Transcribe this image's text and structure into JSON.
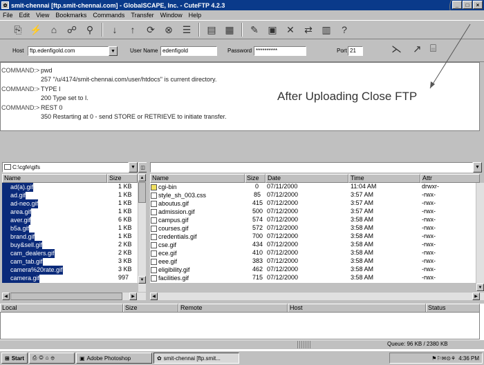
{
  "window": {
    "title": "smit-chennai [ftp.smit-chennai.com] - GlobalSCAPE, Inc. - CuteFTP 4.2.3",
    "controls": [
      "_",
      "□",
      "×"
    ]
  },
  "menu": [
    "File",
    "Edit",
    "View",
    "Bookmarks",
    "Commands",
    "Transfer",
    "Window",
    "Help"
  ],
  "toolbar_icons": [
    "disconnect-icon",
    "reconnect-icon",
    "quick-connect-icon",
    "site-manager-icon",
    "search-icon",
    "download-icon",
    "upload-icon",
    "refresh-icon",
    "stop-icon",
    "queue-icon",
    "view-icon",
    "list-icon",
    "edit-icon",
    "terminal-icon",
    "delete-icon",
    "rename-icon",
    "filter-icon",
    "help-icon"
  ],
  "connection": {
    "host_label": "Host",
    "host_value": "ftp.edenfigold.com",
    "user_label": "User Name",
    "user_value": "edenfigold",
    "password_label": "Password",
    "password_value": "**********",
    "port_label": "Port",
    "port_value": "21"
  },
  "log": [
    {
      "cmd": "COMMAND:>",
      "text": "pwd"
    },
    {
      "cmd": "",
      "text": "257 \"/u/4174/smit-chennai.com/user/htdocs\" is current directory."
    },
    {
      "cmd": "COMMAND:>",
      "text": "TYPE I"
    },
    {
      "cmd": "",
      "text": "200 Type set to I."
    },
    {
      "cmd": "COMMAND:>",
      "text": "REST 0"
    },
    {
      "cmd": "",
      "text": "350 Restarting at 0 - send STORE or RETRIEVE to initiate transfer."
    }
  ],
  "annotation": "After Uploading Close FTP",
  "local": {
    "path": "C:\\cgfe\\gifs",
    "headers": [
      "Name",
      "Size"
    ],
    "files": [
      {
        "name": "ad(a).gif",
        "size": "1 KB"
      },
      {
        "name": "ad.gif",
        "size": "1 KB"
      },
      {
        "name": "ad-neo.gif",
        "size": "1 KB"
      },
      {
        "name": "area.gif",
        "size": "1 KB"
      },
      {
        "name": "aver.gif",
        "size": "6 KB"
      },
      {
        "name": "b5a.gif",
        "size": "1 KB"
      },
      {
        "name": "brand.gif",
        "size": "1 KB"
      },
      {
        "name": "buy&sell.gif",
        "size": "2 KB"
      },
      {
        "name": "cam_dealers.gif",
        "size": "2 KB"
      },
      {
        "name": "cam_tab.gif",
        "size": "3 KB"
      },
      {
        "name": "camera%20rate.gif",
        "size": "3 KB"
      },
      {
        "name": "camera.gif",
        "size": "997"
      }
    ]
  },
  "remote": {
    "path": "",
    "headers": [
      "Name",
      "Size",
      "Date",
      "Time",
      "Attr"
    ],
    "files": [
      {
        "name": "cgi-bin",
        "size": "0",
        "date": "07/11/2000",
        "time": "11:04 AM",
        "attr": "drwxr-"
      },
      {
        "name": "style_sh_003.css",
        "size": "85",
        "date": "07/12/2000",
        "time": "3:57 AM",
        "attr": "-rwx-"
      },
      {
        "name": "aboutus.gif",
        "size": "415",
        "date": "07/12/2000",
        "time": "3:57 AM",
        "attr": "-rwx-"
      },
      {
        "name": "admission.gif",
        "size": "500",
        "date": "07/12/2000",
        "time": "3:57 AM",
        "attr": "-rwx-"
      },
      {
        "name": "campus.gif",
        "size": "574",
        "date": "07/12/2000",
        "time": "3:58 AM",
        "attr": "-rwx-"
      },
      {
        "name": "courses.gif",
        "size": "572",
        "date": "07/12/2000",
        "time": "3:58 AM",
        "attr": "-rwx-"
      },
      {
        "name": "credentials.gif",
        "size": "700",
        "date": "07/12/2000",
        "time": "3:58 AM",
        "attr": "-rwx-"
      },
      {
        "name": "cse.gif",
        "size": "434",
        "date": "07/12/2000",
        "time": "3:58 AM",
        "attr": "-rwx-"
      },
      {
        "name": "ece.gif",
        "size": "410",
        "date": "07/12/2000",
        "time": "3:58 AM",
        "attr": "-rwx-"
      },
      {
        "name": "eee.gif",
        "size": "383",
        "date": "07/12/2000",
        "time": "3:58 AM",
        "attr": "-rwx-"
      },
      {
        "name": "eligibility.gif",
        "size": "462",
        "date": "07/12/2000",
        "time": "3:58 AM",
        "attr": "-rwx-"
      },
      {
        "name": "facilities.gif",
        "size": "715",
        "date": "07/12/2000",
        "time": "3:58 AM",
        "attr": "-rwx-"
      }
    ]
  },
  "queue": {
    "headers": [
      "Local",
      "Size",
      "Remote",
      "Host",
      "Status"
    ]
  },
  "status": {
    "queue_text": "Queue: 96 KB / 2380 KB"
  },
  "taskbar": {
    "start": "Start",
    "items": [
      "Adobe Photoshop",
      "smit-chennai [ftp.smit..."
    ],
    "clock": "4:36 PM"
  }
}
